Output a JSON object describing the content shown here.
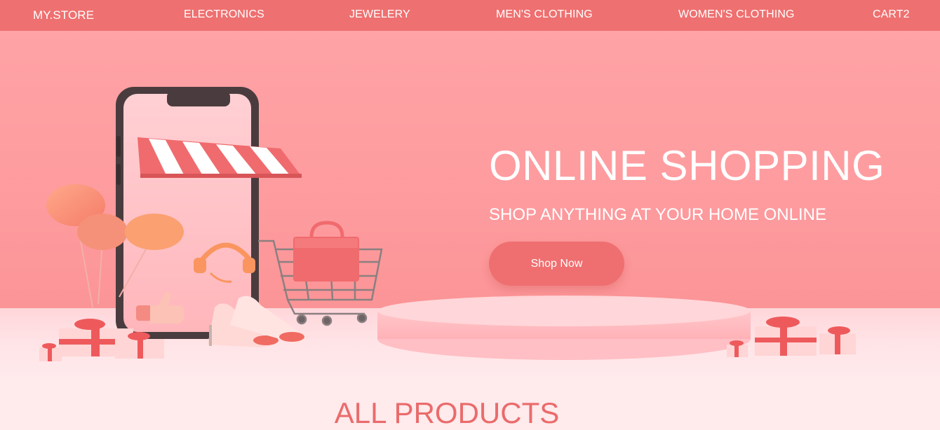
{
  "nav": {
    "brand": "MY.STORE",
    "links": [
      "ELECTRONICS",
      "JEWELERY",
      "MEN'S CLOTHING",
      "WOMEN'S CLOTHING",
      "CART2"
    ]
  },
  "hero": {
    "title": "ONLINE SHOPPING",
    "subtitle": "SHOP ANYTHING AT YOUR HOME ONLINE",
    "cta_label": "Shop Now",
    "illustration": [
      "smartphone-store-icon",
      "awning-icon",
      "balloons-icon",
      "headphones-icon",
      "thumbs-up-icon",
      "high-heels-icon",
      "shopping-cart-icon",
      "shopping-bag-icon",
      "gift-box-icon",
      "podium-icon"
    ]
  },
  "section": {
    "title": "ALL PRODUCTS"
  },
  "colors": {
    "navbar": "#ef7070",
    "hero_bg": "#fd9a9d",
    "button": "#ef6f70",
    "section_title": "#ea6b6b",
    "page_bg": "#ffeaec"
  }
}
